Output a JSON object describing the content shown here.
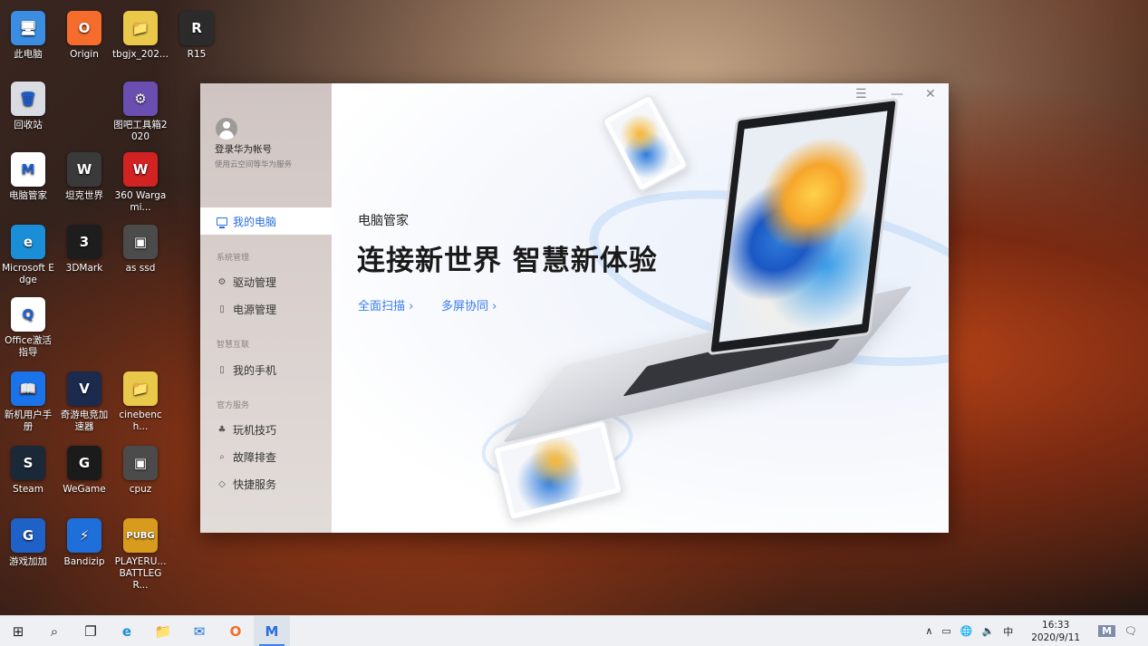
{
  "desktop": {
    "icons": [
      {
        "label": "此电脑",
        "glyph": "🖥",
        "bg": "#3a8de0"
      },
      {
        "label": "Origin",
        "glyph": "O",
        "bg": "#f56c2d"
      },
      {
        "label": "tbgjx_202...",
        "glyph": "📁",
        "bg": "#e9c84a"
      },
      {
        "label": "R15",
        "glyph": "R",
        "bg": "#2b2b2b"
      },
      {
        "label": "回收站",
        "glyph": "🗑",
        "bg": "#d9dde2"
      },
      {
        "label": "图吧工具箱2020",
        "glyph": "⚙",
        "bg": "#6b4fb0"
      },
      {
        "label": "电脑管家",
        "glyph": "M",
        "bg": "#ffffff"
      },
      {
        "label": "坦克世界",
        "glyph": "W",
        "bg": "#3a3a3a"
      },
      {
        "label": "360 Wargami...",
        "glyph": "W",
        "bg": "#d32222"
      },
      {
        "label": "Microsoft Edge",
        "glyph": "e",
        "bg": "#1a8fd8"
      },
      {
        "label": "3DMark",
        "glyph": "3",
        "bg": "#1d1d1d"
      },
      {
        "label": "as ssd",
        "glyph": "▣",
        "bg": "#4b4b4b"
      },
      {
        "label": "Office激活指导",
        "glyph": "Q",
        "bg": "#ffffff"
      },
      {
        "label": "新机用户手册",
        "glyph": "📖",
        "bg": "#1a73e8"
      },
      {
        "label": "奇游电竞加速器",
        "glyph": "V",
        "bg": "#1b2a4d"
      },
      {
        "label": "cinebench...",
        "glyph": "📁",
        "bg": "#e9c84a"
      },
      {
        "label": "Steam",
        "glyph": "S",
        "bg": "#1b2838"
      },
      {
        "label": "WeGame",
        "glyph": "G",
        "bg": "#1b1b1b"
      },
      {
        "label": "cpuz",
        "glyph": "▣",
        "bg": "#4b4b4b"
      },
      {
        "label": "游戏加加",
        "glyph": "G",
        "bg": "#1e62c8"
      },
      {
        "label": "Bandizip",
        "glyph": "⚡",
        "bg": "#1e6fd9"
      },
      {
        "label": "PLAYERU... BATTLEGR...",
        "glyph": "PUBG",
        "bg": "#d99b1d"
      }
    ]
  },
  "app": {
    "window_controls": {
      "menu": "☰",
      "minimize": "—",
      "close": "✕"
    },
    "account": {
      "title": "登录华为帐号",
      "subtitle": "使用云空间等华为服务"
    },
    "nav_active": "我的电脑",
    "groups": [
      {
        "label": "系统管理",
        "items": [
          {
            "label": "驱动管理",
            "icon": "⚙"
          },
          {
            "label": "电源管理",
            "icon": "▯"
          }
        ]
      },
      {
        "label": "智慧互联",
        "items": [
          {
            "label": "我的手机",
            "icon": "▯"
          }
        ]
      },
      {
        "label": "官方服务",
        "items": [
          {
            "label": "玩机技巧",
            "icon": "♣"
          },
          {
            "label": "故障排查",
            "icon": "⌕"
          },
          {
            "label": "快捷服务",
            "icon": "◇"
          }
        ]
      }
    ],
    "main": {
      "app_name": "电脑管家",
      "headline": "连接新世界 智慧新体验",
      "link_scan": "全面扫描 ›",
      "link_multiscreen": "多屏协同 ›"
    }
  },
  "taskbar": {
    "start": "⊞",
    "search": "⌕",
    "taskview": "❐",
    "apps": [
      {
        "name": "edge",
        "glyph": "e"
      },
      {
        "name": "explorer",
        "glyph": "📁"
      },
      {
        "name": "mail",
        "glyph": "✉"
      },
      {
        "name": "origin",
        "glyph": "O"
      },
      {
        "name": "pc-manager",
        "glyph": "M"
      }
    ],
    "tray": {
      "chevron": "∧",
      "battery": "▭",
      "network": "🌐",
      "volume": "🔈",
      "ime": "中",
      "notification": "🗨"
    },
    "time": "16:33",
    "date": "2020/9/11"
  }
}
